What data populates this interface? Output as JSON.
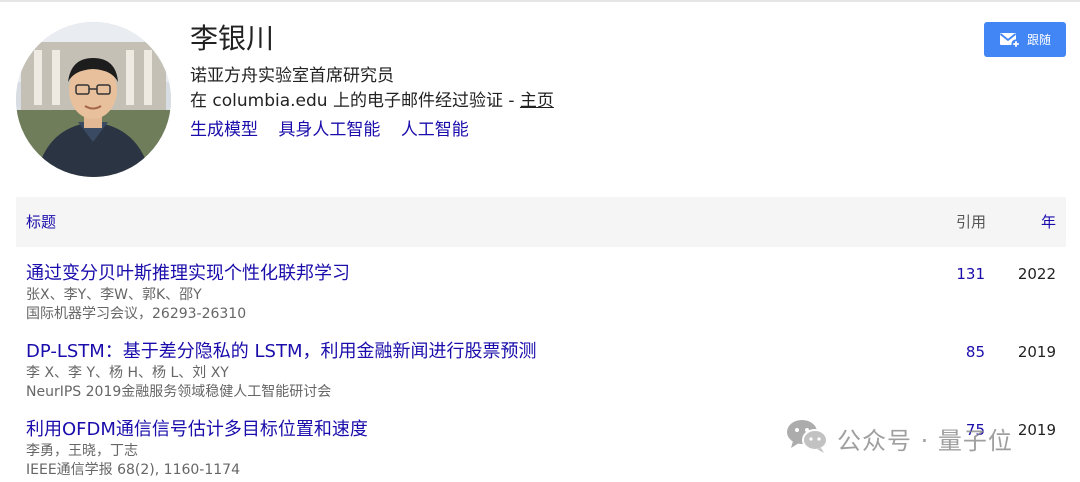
{
  "profile": {
    "name": "李银川",
    "affiliation": "诺亚方舟实验室首席研究员",
    "email_verified_text": "在 columbia.edu 上的电子邮件经过验证 - ",
    "homepage_label": "主页",
    "interests": [
      "生成模型",
      "具身人工智能",
      "人工智能"
    ]
  },
  "follow_button": {
    "label": "跟随"
  },
  "table": {
    "headers": {
      "title": "标题",
      "cited_by": "引用",
      "year": "年"
    },
    "rows": [
      {
        "title": "通过变分贝叶斯推理实现个性化联邦学习",
        "authors": "张X、李Y、李W、郭K、邵Y",
        "venue": "国际机器学习会议，26293-26310",
        "cited": "131",
        "year": "2022"
      },
      {
        "title": "DP-LSTM：基于差分隐私的 LSTM，利用金融新闻进行股票预测",
        "authors": "李 X、李 Y、杨 H、杨 L、刘 XY",
        "venue": "NeurIPS 2019金融服务领域稳健人工智能研讨会",
        "cited": "85",
        "year": "2019"
      },
      {
        "title": "利用OFDM通信信号估计多目标位置和速度",
        "authors": "李勇，王晓，丁志",
        "venue": "IEEE通信学报 68(2), 1160-1174",
        "cited": "75",
        "year": "2019"
      }
    ]
  },
  "watermark": {
    "text": "公众号 · 量子位"
  },
  "colors": {
    "link": "#1a0dab",
    "button": "#4285f4",
    "header_bg": "#f5f5f5"
  }
}
